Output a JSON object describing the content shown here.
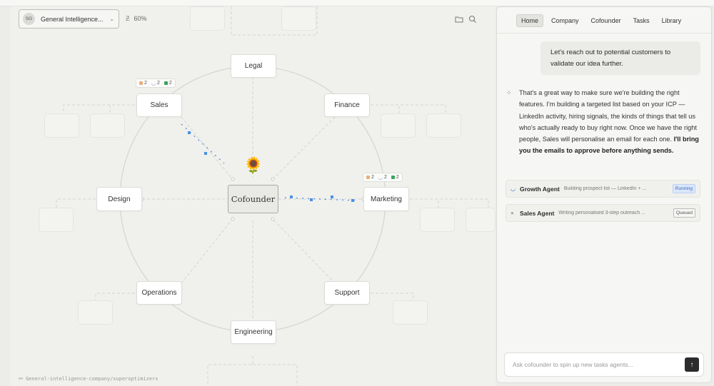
{
  "header": {
    "workspace_initials": "SG",
    "workspace_name": "General Intelligence...",
    "zoom_icon": "z-icon",
    "zoom_level": "60%",
    "folder_icon": "folder-icon",
    "search_icon": "search-icon"
  },
  "graph": {
    "center_label": "Cofounder",
    "center_emoji": "🌻",
    "nodes": {
      "legal": "Legal",
      "finance": "Finance",
      "sales": "Sales",
      "design": "Design",
      "marketing": "Marketing",
      "operations": "Operations",
      "support": "Support",
      "engineering": "Engineering"
    },
    "sales_stats": {
      "a": "2",
      "b": "2",
      "c": "2"
    },
    "marketing_stats": {
      "a": "2",
      "b": "2",
      "c": "2"
    }
  },
  "footer": {
    "path": "General-intelligence-company/superoptimizers"
  },
  "panel": {
    "tabs": [
      "Home",
      "Company",
      "Cofounder",
      "Tasks",
      "Library"
    ],
    "active_tab": "Home",
    "user_message": "Let's reach out to potential customers to validate our idea further.",
    "assistant_text": "That's a great way to make sure we're building the right features. I'm building a targeted list based on your ICP — LinkedIn activity, hiring signals, the kinds of things that tell us who's actually ready to buy right now. Once we have the right people, Sales will personalise an email for each one.",
    "assistant_bold": "I'll bring you the emails to approve before anything sends.",
    "agents": [
      {
        "name": "Growth Agent",
        "desc": "Building prospect list — LinkedIn + ...",
        "status": "Running",
        "icon": "spinner-icon"
      },
      {
        "name": "Sales Agent",
        "desc": "Writing personalised 3-step outreach ...",
        "status": "Queued",
        "icon": "queued-dot-icon"
      }
    ],
    "composer_placeholder": "Ask cofounder to spin up new tasks agents...",
    "send_icon": "arrow-up-icon"
  },
  "colors": {
    "running_badge": "#dbe7fa",
    "accent_blue": "#4a90e2",
    "send_button": "#2c2c2c"
  }
}
